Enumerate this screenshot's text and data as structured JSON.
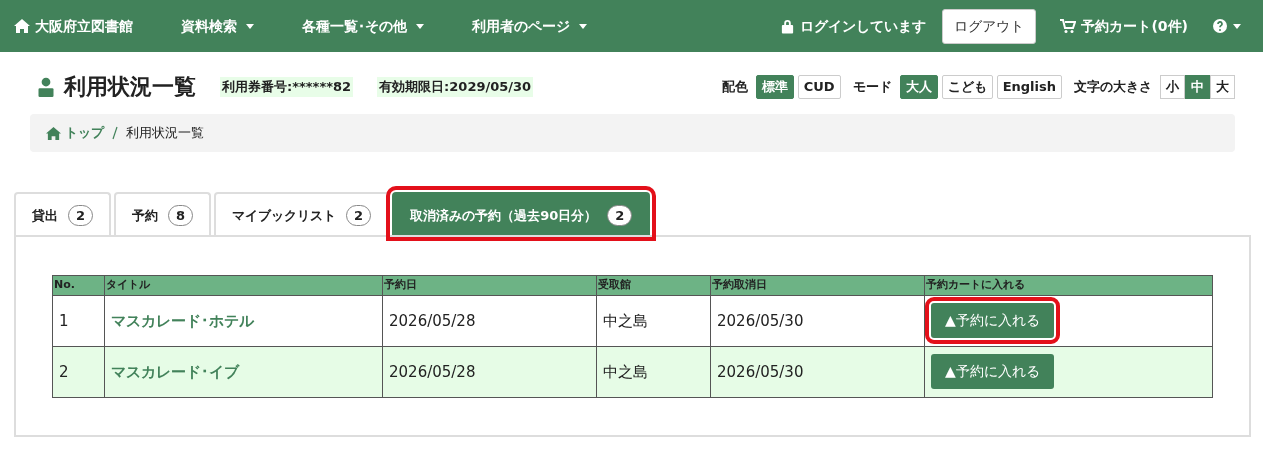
{
  "navbar": {
    "brand": "大阪府立図書館",
    "menus": [
      {
        "label": "資料検索"
      },
      {
        "label": "各種一覧･その他"
      },
      {
        "label": "利用者のページ"
      }
    ],
    "login_status": "ログインしています",
    "logout_button": "ログアウト",
    "cart": "予約カート(0件)"
  },
  "header": {
    "title": "利用状況一覧",
    "card_number": "利用券番号:******82",
    "expiry": "有効期限日:2029/05/30"
  },
  "display_options": [
    {
      "label": "配色",
      "options": [
        {
          "label": "標準",
          "selected": true
        },
        {
          "label": "CUD",
          "selected": false
        }
      ]
    },
    {
      "label": "モード",
      "options": [
        {
          "label": "大人",
          "selected": true
        },
        {
          "label": "こども",
          "selected": false
        },
        {
          "label": "English",
          "selected": false
        }
      ]
    },
    {
      "label": "文字の大きさ",
      "options": [
        {
          "label": "小",
          "selected": false
        },
        {
          "label": "中",
          "selected": true
        },
        {
          "label": "大",
          "selected": false
        }
      ]
    }
  ],
  "breadcrumb": [
    {
      "label": "トップ",
      "kind": "link"
    },
    {
      "label": "利用状況一覧",
      "kind": "current"
    }
  ],
  "tabs": [
    {
      "label": "貸出",
      "count": "2",
      "selected": false,
      "highlighted": false
    },
    {
      "label": "予約",
      "count": "8",
      "selected": false,
      "highlighted": false
    },
    {
      "label": "マイブックリスト",
      "count": "2",
      "selected": false,
      "highlighted": false
    },
    {
      "label": "取消済みの予約（過去90日分）",
      "count": "2",
      "selected": true,
      "highlighted": true
    }
  ],
  "table": {
    "columns": [
      "No.",
      "タイトル",
      "予約日",
      "受取館",
      "予約取消日",
      "予約カートに入れる"
    ],
    "rows": [
      {
        "no": "1",
        "title": "マスカレード･ホテル",
        "reserved": "2026/05/28",
        "library": "中之島",
        "cancelled": "2026/05/30",
        "button": "▲予約に入れる",
        "highlighted": true
      },
      {
        "no": "2",
        "title": "マスカレード･イブ",
        "reserved": "2026/05/28",
        "library": "中之島",
        "cancelled": "2026/05/30",
        "button": "▲予約に入れる",
        "highlighted": false
      }
    ]
  }
}
